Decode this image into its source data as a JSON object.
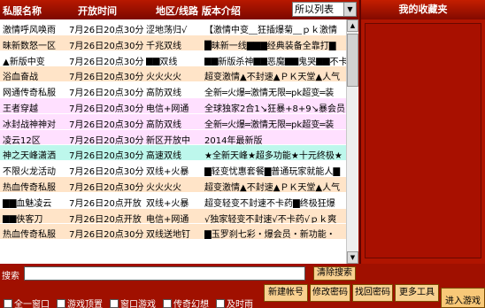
{
  "header": {
    "name": "私服名称",
    "time": "开放时间",
    "region": "地区/线路 版本介绍",
    "filter_value": "所以列表",
    "favorites_title": "我的收藏夹"
  },
  "rows": [
    {
      "name": "激情呼风唤雨",
      "time": "7月26日20点30分",
      "line": "涩地荡归√",
      "desc": "【激情中变__狂插爆菊__ｐｋ激情",
      "bg": "#ffffff"
    },
    {
      "name": "昧新数怒一区",
      "time": "7月26日20点30分",
      "line": "千兆双线",
      "desc": "█昧新一线▇▇▇经典装备全靠打▇",
      "bg": "#ffe4c8"
    },
    {
      "name": "▲新版中变",
      "time": "7月26日20点30分",
      "line": "▇▇双线",
      "desc": "▇▇新版杀神▇▇恶魔▇▇鬼哭▇▇不卡药",
      "bg": "#ffffff"
    },
    {
      "name": "浴血奋战",
      "time": "7月26日20点30分",
      "line": "火火火火",
      "desc": "超变激情▲不封速▲ＰＫ天堂▲人气",
      "bg": "#ffe4c8"
    },
    {
      "name": "网通传奇私服",
      "time": "7月26日20点30分",
      "line": "高防双线",
      "desc": "全新═火爆═激情无限═pk超变═装",
      "bg": "#ffffff"
    },
    {
      "name": "王者穿越",
      "time": "7月26日20点30分",
      "line": "电信+网通",
      "desc": "全球独家2合1↘狂暴+8+9↘暴会员↘",
      "bg": "#ffe0ff"
    },
    {
      "name": "冰封战神神对",
      "time": "7月26日20点30分",
      "line": "高防双线",
      "desc": "全新═火爆═激情无限═pk超变═装",
      "bg": "#ffe0ff"
    },
    {
      "name": "凌云12区",
      "time": "7月26日20点30分",
      "line": "新区开放中",
      "desc": "2014年最新版",
      "bg": "#ffe0ff"
    },
    {
      "name": "神之天峰潇洒",
      "time": "7月26日20点30分",
      "line": "高速双线",
      "desc": "★全新天峰★超多功能★十元终极★",
      "bg": "#bdf7ec"
    },
    {
      "name": "不限火龙活动",
      "time": "7月26日20点30分",
      "line": "双线+火暴",
      "desc": "▇轻变忧惠套餐▇普通玩家就能人▇",
      "bg": "#ffffff"
    },
    {
      "name": "热血传奇私服",
      "time": "7月26日20点30分",
      "line": "火火火火",
      "desc": "超变激情▲不封速▲ＰＫ天堂▲人气",
      "bg": "#ffe4c8"
    },
    {
      "name": "▇▇血魅凌云",
      "time": "7月26日20点开放",
      "line": "双线+火暴",
      "desc": "超变轻变不封速不卡药▇终极狂爆",
      "bg": "#ffffff"
    },
    {
      "name": "▇▇侠客刀",
      "time": "7月26日20点开放",
      "line": "电信+网通",
      "desc": "√独家轻变不封速√不卡药√ｐｋ爽",
      "bg": "#ffe4c8"
    },
    {
      "name": "热血传奇私服",
      "time": "7月26日20点30分",
      "line": "双线送地钉",
      "desc": "▇玉罗刹七彩・爆会员・新功能・",
      "bg": "#ffe4c8"
    }
  ],
  "search": {
    "label": "搜索",
    "value": "",
    "clear_label": "清除搜索"
  },
  "bottom": {
    "checkboxes": [
      "全一窗口",
      "游戏顶置",
      "窗口游戏",
      "传奇幻想",
      "及时雨"
    ],
    "buttons": {
      "new_account": "新建帐号",
      "change_password": "修改密码",
      "recover_password": "找回密码",
      "more_tools": "更多工具",
      "enter_game": "进入游戏"
    }
  }
}
